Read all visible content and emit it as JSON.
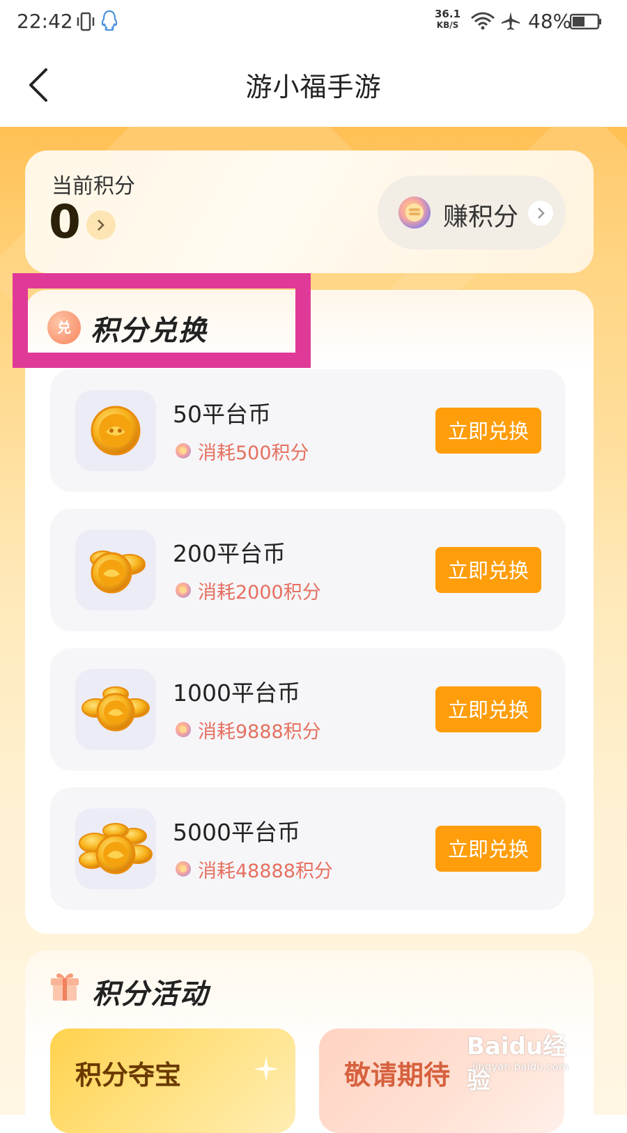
{
  "status_bar": {
    "time": "22:42",
    "speed_value": "36.1",
    "speed_unit": "KB/S",
    "battery": "48%"
  },
  "nav": {
    "title": "游小福手游"
  },
  "points": {
    "label": "当前积分",
    "value": "0",
    "earn_label": "赚积分"
  },
  "exchange": {
    "title": "积分兑换",
    "title_icon_text": "兑",
    "items": [
      {
        "name": "50平台币",
        "cost": "消耗500积分",
        "button": "立即兑换",
        "icon": "coin-single-icon"
      },
      {
        "name": "200平台币",
        "cost": "消耗2000积分",
        "button": "立即兑换",
        "icon": "coin-pair-icon"
      },
      {
        "name": "1000平台币",
        "cost": "消耗9888积分",
        "button": "立即兑换",
        "icon": "coin-triple-icon"
      },
      {
        "name": "5000平台币",
        "cost": "消耗48888积分",
        "button": "立即兑换",
        "icon": "coin-pile-icon"
      }
    ]
  },
  "activity": {
    "title": "积分活动",
    "tiles": [
      {
        "label": "积分夺宝"
      },
      {
        "label": "敬请期待"
      }
    ]
  },
  "watermark": {
    "logo": "Baidu经验",
    "url": "jingyan.baidu.com"
  },
  "colors": {
    "accent_orange": "#ff9d0a",
    "cost_red": "#e5705f",
    "highlight_magenta": "#e03a98"
  }
}
